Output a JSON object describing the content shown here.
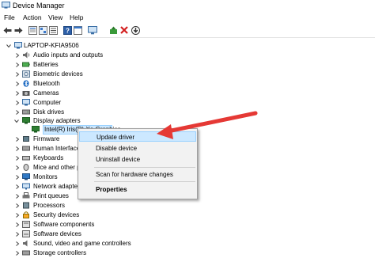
{
  "window": {
    "title": "Device Manager"
  },
  "menu": [
    "File",
    "Action",
    "View",
    "Help"
  ],
  "toolbar_icons": [
    "back-arrow-icon",
    "forward-arrow-icon",
    "properties-icon",
    "show-hidden-icon",
    "help-icon",
    "view-list-icon",
    "scan-monitor-icon",
    "add-driver-icon",
    "remove-icon",
    "download-icon"
  ],
  "tree": {
    "root": "LAPTOP-KFIA9506",
    "items": [
      "Audio inputs and outputs",
      "Batteries",
      "Biometric devices",
      "Bluetooth",
      "Cameras",
      "Computer",
      "Disk drives",
      "Display adapters",
      "Intel(R) Iris(R) Xe Graphics",
      "Firmware",
      "Human Interface Devices",
      "Keyboards",
      "Mice and other pointing devices",
      "Monitors",
      "Network adapters",
      "Print queues",
      "Processors",
      "Security devices",
      "Software components",
      "Software devices",
      "Sound, video and game controllers",
      "Storage controllers"
    ]
  },
  "context_menu": {
    "items": [
      "Update driver",
      "Disable device",
      "Uninstall device",
      "Scan for hardware changes",
      "Properties"
    ],
    "highlighted": "Update driver"
  },
  "colors": {
    "arrow": "#e53935",
    "highlight": "#cce8ff"
  }
}
